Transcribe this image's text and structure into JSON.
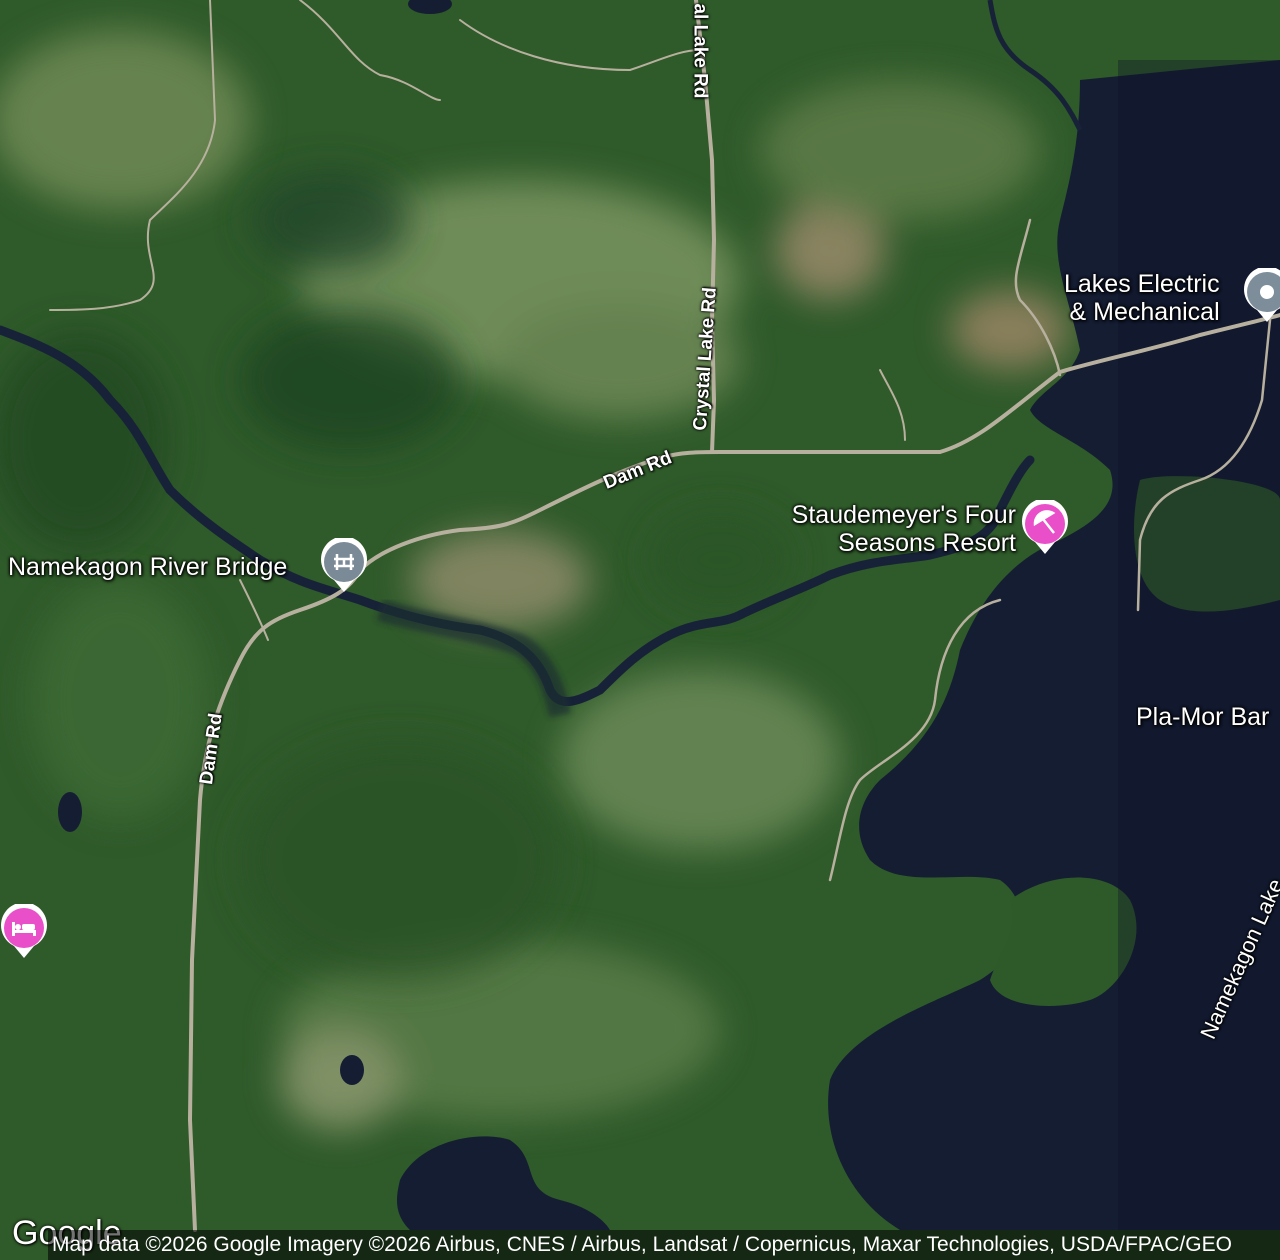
{
  "map": {
    "type": "satellite",
    "roads": {
      "dam_rd_upper": "Dam Rd",
      "dam_rd_lower": "Dam Rd",
      "crystal_lake_rd_upper": "al Lake Rd",
      "crystal_lake_rd_lower": "Crystal Lake Rd"
    },
    "water": {
      "namekagon_lake": "Namekagon Lake"
    },
    "places": {
      "namekagon_river_bridge": "Namekagon River Bridge",
      "lakes_electric_line1": "Lakes Electric",
      "lakes_electric_line2": "& Mechanical",
      "staudemeyer_line1": "Staudemeyer's Four",
      "staudemeyer_line2": "Seasons Resort",
      "pla_mor": "Pla-Mor Bar"
    },
    "colors": {
      "bridge_pin": "#7b8a97",
      "resort_pin": "#e94fc8",
      "lodging_pin": "#e94fc8",
      "business_pin": "#7d8d99",
      "water": "#151d33",
      "forest": "#2f5a2a"
    },
    "icons": {
      "bridge": "bridge-icon",
      "resort": "beach-umbrella-icon",
      "lodging": "bed-icon",
      "business": "location-dot-icon"
    }
  },
  "footer": {
    "logo": "Google",
    "attribution": "Map data ©2026 Google Imagery ©2026 Airbus, CNES / Airbus, Landsat / Copernicus, Maxar Technologies, USDA/FPAC/GEO"
  }
}
